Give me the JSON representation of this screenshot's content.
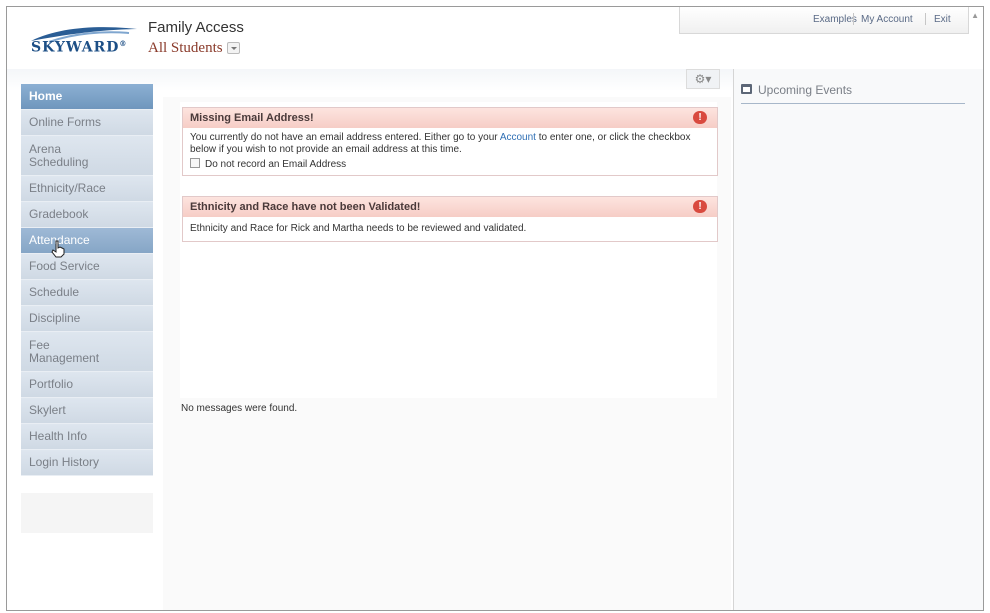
{
  "header": {
    "logo_text": "SKYWARD",
    "logo_mark": "®",
    "app_title": "Family Access",
    "student_selector": "All Students"
  },
  "toplinks": {
    "examples": "Examples",
    "my_account": "My Account",
    "exit": "Exit"
  },
  "sidebar": {
    "items": [
      {
        "label": "Home",
        "state": "active"
      },
      {
        "label": "Online Forms"
      },
      {
        "label": "Arena Scheduling"
      },
      {
        "label": "Ethnicity/Race"
      },
      {
        "label": "Gradebook"
      },
      {
        "label": "Attendance",
        "state": "hover"
      },
      {
        "label": "Food Service"
      },
      {
        "label": "Schedule"
      },
      {
        "label": "Discipline"
      },
      {
        "label": "Fee Management"
      },
      {
        "label": "Portfolio"
      },
      {
        "label": "Skylert"
      },
      {
        "label": "Health Info"
      },
      {
        "label": "Login History"
      }
    ]
  },
  "alerts": [
    {
      "title": "Missing Email Address!",
      "body_before_link": "You currently do not have an email address entered. Either go to your ",
      "link": "Account",
      "body_after_link": " to enter one, or click the checkbox below if you wish to not provide an email address at this time.",
      "checkbox_label": "Do not record an Email Address"
    },
    {
      "title": "Ethnicity and Race have not been Validated!",
      "body": "Ethnicity and Race for Rick and Martha needs to be reviewed and validated."
    }
  ],
  "messages": {
    "empty": "No messages were found."
  },
  "right_panel": {
    "title": "Upcoming Events"
  },
  "colors": {
    "nav_active": "#7aa0c6",
    "alert_header": "#f8d4ce",
    "alert_icon": "#d94a3f",
    "link": "#2f6fb4"
  }
}
